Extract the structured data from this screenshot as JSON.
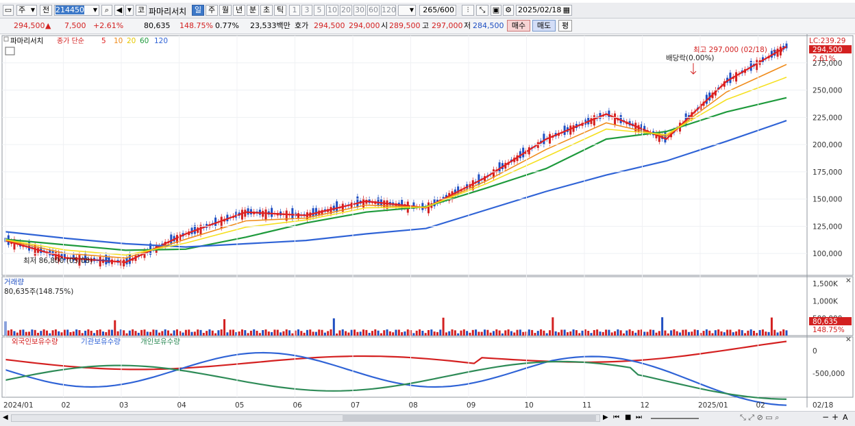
{
  "toolbar": {
    "market_label": "주",
    "prev_label": "전",
    "code_value": "214450",
    "kor_label": "코",
    "stock_name": "파마리서치",
    "period_tabs": [
      "일",
      "주",
      "월",
      "년",
      "분",
      "초",
      "틱"
    ],
    "minute_tabs": [
      "1",
      "3",
      "5",
      "10",
      "20",
      "30",
      "60",
      "120"
    ],
    "count_value": "265",
    "count_total": "/600",
    "date_value": "2025/02/18"
  },
  "quote": {
    "price": "294,500",
    "change": "7,500",
    "change_pct": "+2.61%",
    "volume": "80,635",
    "volume_pct": "148.75%",
    "turnover_pct": "0.77%",
    "amount": "23,533백만",
    "bid_label": "호가",
    "bid1": "294,500",
    "bid2": "294,000",
    "open_label": "시",
    "open": "289,500",
    "high_label": "고",
    "high": "297,000",
    "low_label": "저",
    "low": "284,500",
    "buy_label": "매수",
    "sell_label": "매도",
    "eval_label": "평"
  },
  "price_panel": {
    "name": "파마리서치",
    "ma_prefix": "종가 단순",
    "ma_periods": [
      "5",
      "10",
      "20",
      "60",
      "120"
    ],
    "lc_label": "LC:239.29",
    "current_price": "294,500",
    "current_pct": "2.61%",
    "high_annot": "최고 297,000 (02/18)",
    "dividend_annot": "배당락(0.00%)",
    "low_annot": "최저 86,800 (05/08)",
    "y_ticks": [
      "275,000",
      "250,000",
      "225,000",
      "200,000",
      "175,000",
      "150,000",
      "125,000",
      "100,000"
    ]
  },
  "volume_panel": {
    "title": "거래량",
    "value": "80,635주(148.75%)",
    "current": "80,635",
    "current_pct": "148.75%",
    "y_ticks": [
      "1,500K",
      "1,000K",
      "500,000"
    ]
  },
  "holdings_panel": {
    "series_labels": [
      "외국인보유수량",
      "기관보유수량",
      "개인보유수량"
    ],
    "y_ticks": [
      "0",
      "-500,000"
    ]
  },
  "x_axis": {
    "labels": [
      "2024/01",
      "02",
      "03",
      "04",
      "05",
      "06",
      "07",
      "08",
      "09",
      "10",
      "11",
      "12",
      "2025/01",
      "02"
    ],
    "current_label": "02/18"
  },
  "colors": {
    "up": "#d32020",
    "down": "#1f4fc2",
    "ma5": "#e02020",
    "ma10": "#f08c1c",
    "ma20": "#f5e020",
    "ma60": "#1e9a3c",
    "ma120": "#2f63d6",
    "foreign": "#d42020",
    "institution": "#2f63d6",
    "individual": "#2e8b57"
  },
  "chart_data": {
    "type": "line",
    "x": [
      "2024/01",
      "02",
      "03",
      "04",
      "05",
      "06",
      "07",
      "08",
      "09",
      "10",
      "11",
      "12",
      "2025/01",
      "02"
    ],
    "series": [
      {
        "name": "5",
        "values": [
          112000,
          96000,
          92000,
          118000,
          138000,
          135000,
          148000,
          142000,
          170000,
          205000,
          228000,
          205000,
          258000,
          290000
        ]
      },
      {
        "name": "60",
        "values": [
          113000,
          108000,
          103000,
          104000,
          115000,
          128000,
          138000,
          143000,
          160000,
          178000,
          205000,
          212000,
          230000,
          243000
        ]
      },
      {
        "name": "120",
        "values": [
          120000,
          114000,
          109000,
          106000,
          109000,
          112000,
          118000,
          123000,
          140000,
          157000,
          172000,
          185000,
          203000,
          222000
        ]
      }
    ],
    "ylim": [
      80000,
      300000
    ]
  }
}
